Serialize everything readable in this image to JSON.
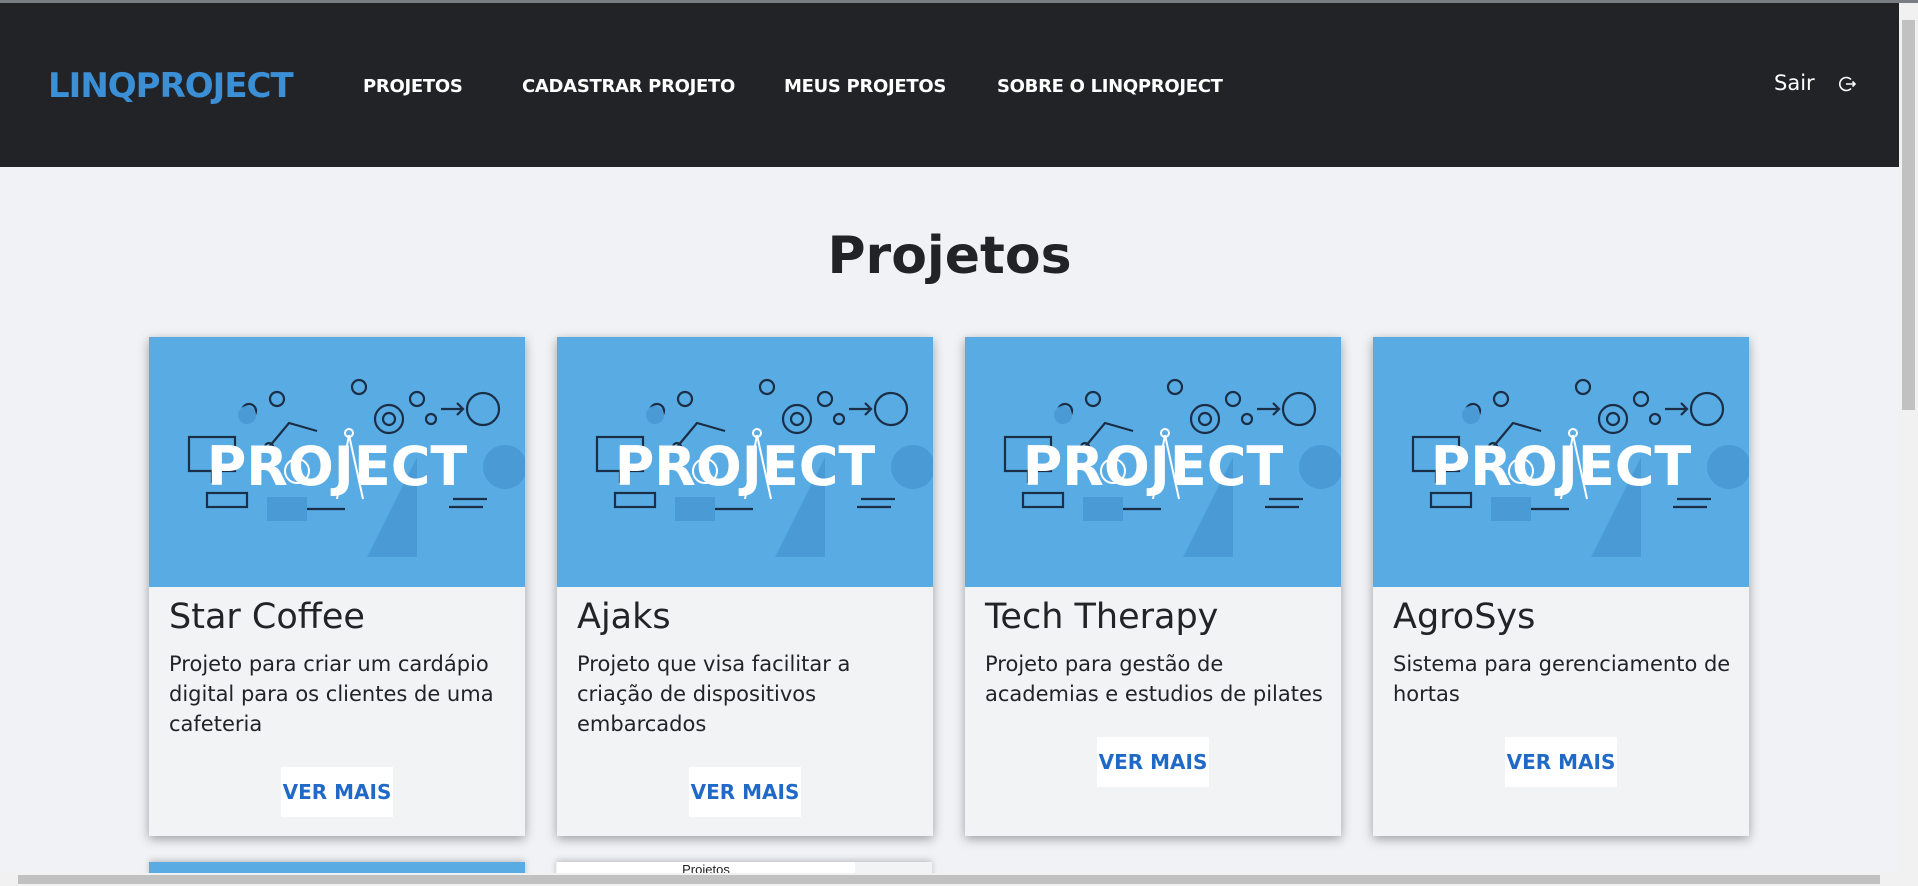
{
  "app": {
    "brand": "LINQPROJECT"
  },
  "nav": {
    "links": [
      {
        "label": "PROJETOS"
      },
      {
        "label": "CADASTRAR PROJETO"
      },
      {
        "label": "MEUS PROJETOS"
      },
      {
        "label": "SOBRE O LINQPROJECT"
      }
    ],
    "logout_label": "Sair",
    "logout_icon": "logout-icon"
  },
  "page": {
    "title": "Projetos"
  },
  "cards": [
    {
      "image_text": "PROJECT",
      "title": "Star Coffee",
      "description": "Projeto para criar um cardápio digital para os clientes de uma cafeteria",
      "button": "VER MAIS"
    },
    {
      "image_text": "PROJECT",
      "title": "Ajaks",
      "description": "Projeto que visa facilitar a criação de dispositivos embarcados",
      "button": "VER MAIS"
    },
    {
      "image_text": "PROJECT",
      "title": "Tech Therapy",
      "description": "Projeto para gestão de academias e estudios de pilates",
      "button": "VER MAIS"
    },
    {
      "image_text": "PROJECT",
      "title": "AgroSys",
      "description": "Sistema para gerenciamento de hortas",
      "button": "VER MAIS"
    }
  ],
  "tooltip": "Projetos",
  "colors": {
    "navbar": "#222326",
    "brand": "#3b8fd6",
    "card_image": "#58ace3",
    "button_text": "#2169c7",
    "background": "#f0f2f5"
  }
}
